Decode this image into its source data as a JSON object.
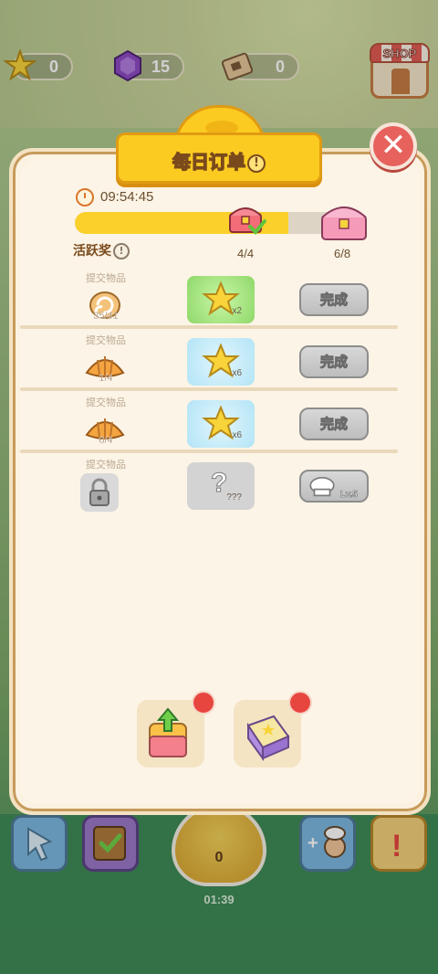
{
  "header": {
    "stars": "0",
    "gems": "15",
    "tickets": "0",
    "shop_label": "SHOP"
  },
  "dialog": {
    "title": "每日订单",
    "timer": "09:54:45",
    "active_reward_label": "活跃奖",
    "progress": {
      "current": 6,
      "max": 8,
      "fraction": 0.78
    },
    "milestones": [
      {
        "label": "4/4",
        "claimed": true
      },
      {
        "label": "6/8",
        "claimed": false
      }
    ]
  },
  "orders": [
    {
      "submit_label": "提交物品",
      "item": "swiss-roll",
      "count": "35/41",
      "reward_qty": "x2",
      "reward_ready": true,
      "button": "完成"
    },
    {
      "submit_label": "提交物品",
      "item": "croissant",
      "count": "1/4",
      "reward_qty": "x6",
      "reward_ready": false,
      "button": "完成"
    },
    {
      "submit_label": "提交物品",
      "item": "croissant",
      "count": "0/4",
      "reward_qty": "x6",
      "reward_ready": false,
      "button": "完成"
    },
    {
      "submit_label": "提交物品",
      "item": "locked",
      "count": "",
      "reward_qty": "???",
      "locked": true,
      "button": "Lv.5"
    }
  ],
  "boosters": [
    {
      "name": "refresh-box"
    },
    {
      "name": "star-box"
    }
  ],
  "bottom_bar": {
    "center_count": "0",
    "timer": "01:39"
  },
  "colors": {
    "accent_yellow": "#fccb21",
    "panel_bg": "#fbf2e2",
    "close_red": "#e7625d",
    "reward_green": "#9fe07a",
    "reward_blue": "#bfe9f8"
  }
}
